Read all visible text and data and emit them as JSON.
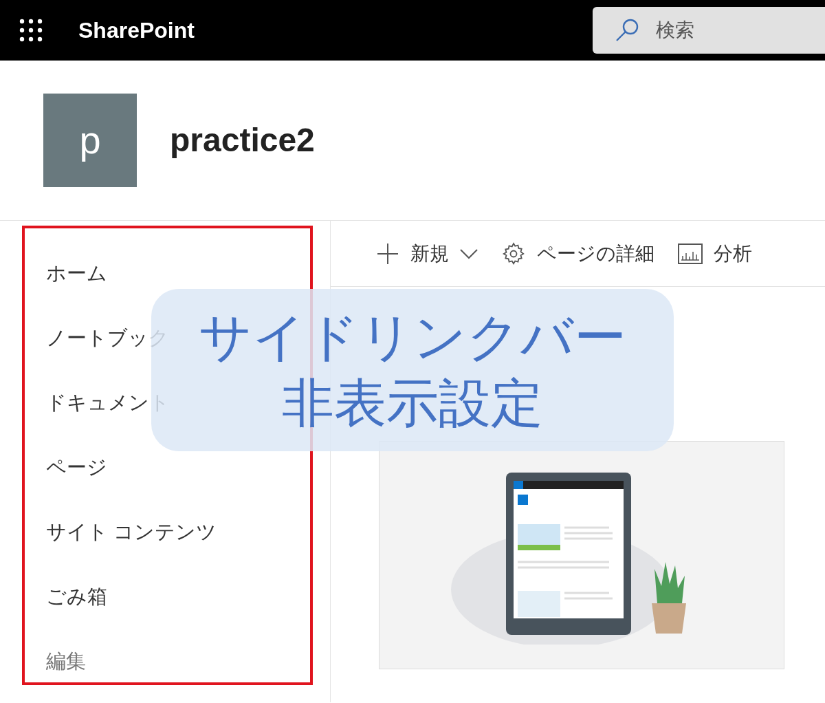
{
  "top_bar": {
    "app_name": "SharePoint",
    "search": {
      "placeholder": "検索"
    }
  },
  "site": {
    "logo_letter": "p",
    "title": "practice2"
  },
  "nav": {
    "items": [
      {
        "label": "ホーム",
        "kind": "link"
      },
      {
        "label": "ノートブック",
        "kind": "link"
      },
      {
        "label": "ドキュメント",
        "kind": "link"
      },
      {
        "label": "ページ",
        "kind": "link"
      },
      {
        "label": "サイト コンテンツ",
        "kind": "link"
      },
      {
        "label": "ごみ箱",
        "kind": "link"
      },
      {
        "label": "編集",
        "kind": "edit"
      }
    ]
  },
  "command_bar": [
    {
      "label": "新規",
      "kind": "new"
    },
    {
      "label": "ページの詳細",
      "kind": "details"
    },
    {
      "label": "分析",
      "kind": "analytics"
    }
  ],
  "callout": {
    "lines": [
      "サイドリンクバー",
      "非表示設定"
    ]
  }
}
